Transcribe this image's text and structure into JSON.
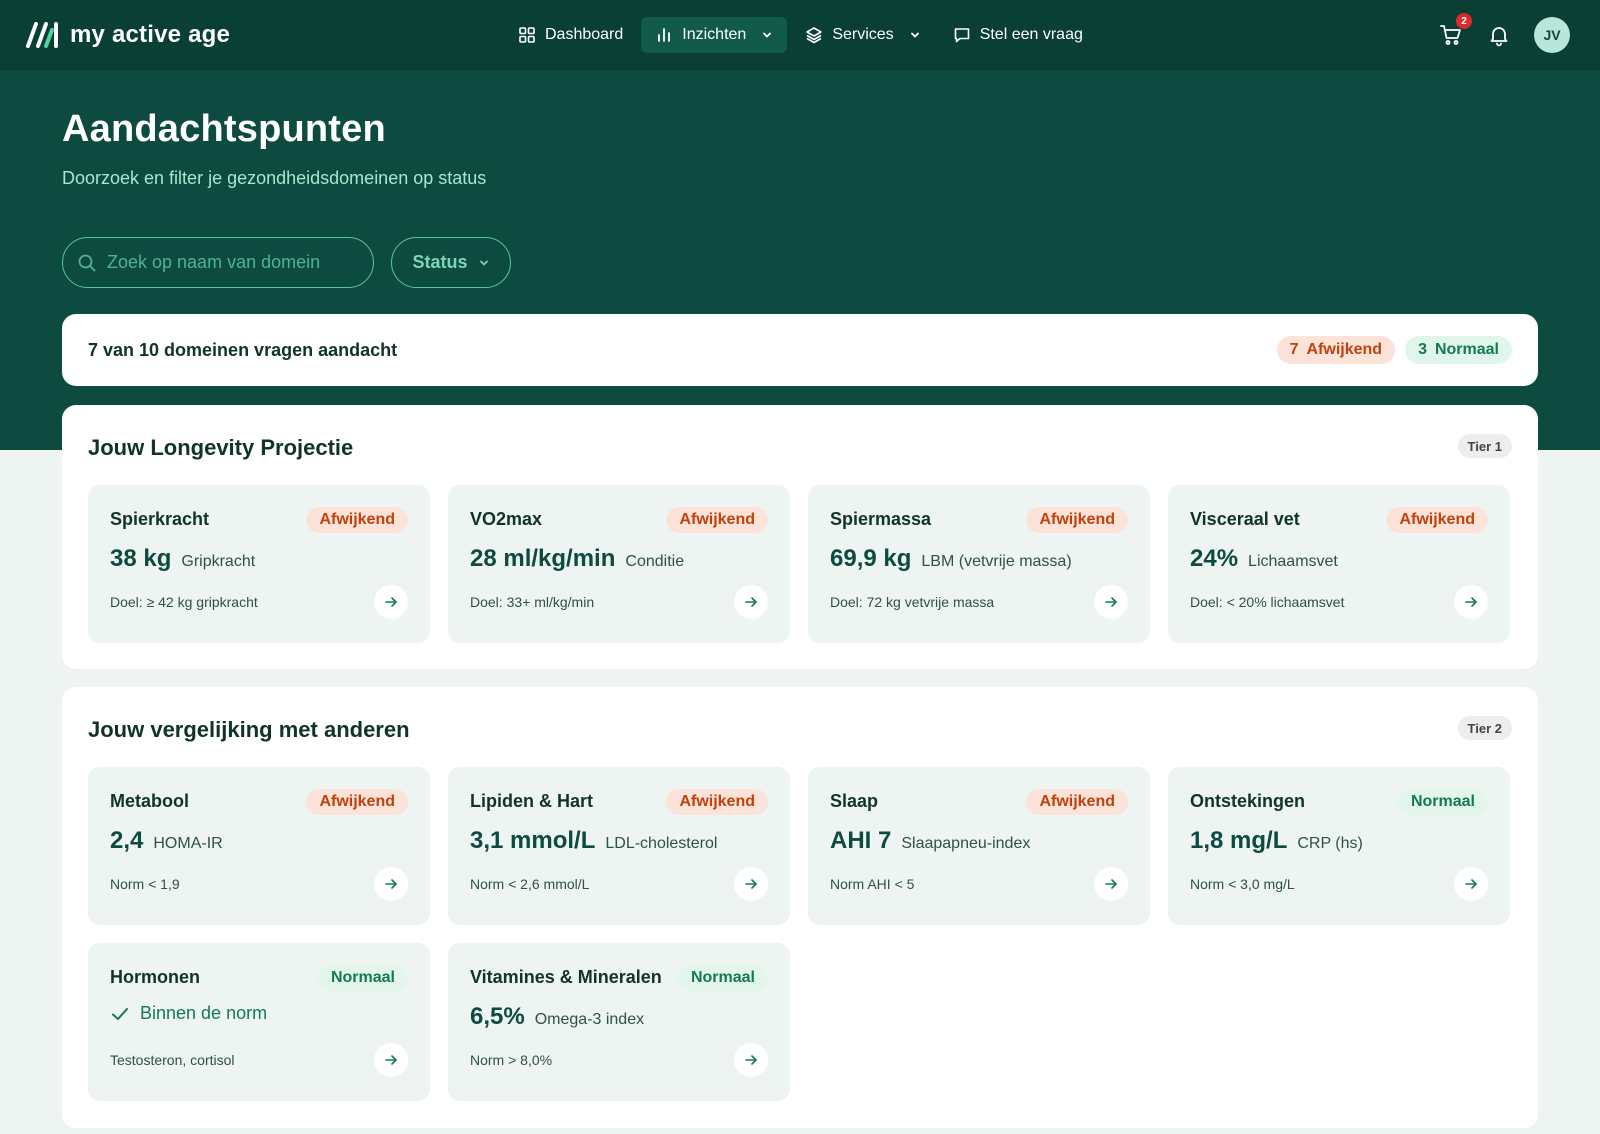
{
  "brand": {
    "name": "my active age"
  },
  "nav": {
    "items": [
      {
        "label": "Dashboard",
        "icon": "grid-icon"
      },
      {
        "label": "Inzichten",
        "icon": "bar-chart-icon"
      },
      {
        "label": "Services",
        "icon": "layers-icon"
      },
      {
        "label": "Stel een vraag",
        "icon": "chat-icon"
      }
    ],
    "cart_count": "2",
    "avatar_initials": "JV"
  },
  "header": {
    "title": "Aandachtspunten",
    "subtitle": "Doorzoek en filter je gezondheidsdomeinen op status"
  },
  "filters": {
    "search_placeholder": "Zoek op naam van domein",
    "status_label": "Status"
  },
  "summary": {
    "text": "7 van 10 domeinen vragen aandacht",
    "deviating_count": "7",
    "deviating_label": "Afwijkend",
    "normal_count": "3",
    "normal_label": "Normaal"
  },
  "sections": [
    {
      "title": "Jouw Longevity Projectie",
      "tier": "Tier 1",
      "cards": [
        {
          "title": "Spierkracht",
          "status": "Afwijkend",
          "value": "38 kg",
          "label": "Gripkracht",
          "note": "Doel: ≥ 42 kg gripkracht"
        },
        {
          "title": "VO2max",
          "status": "Afwijkend",
          "value": "28 ml/kg/min",
          "label": "Conditie",
          "note": "Doel: 33+ ml/kg/min"
        },
        {
          "title": "Spiermassa",
          "status": "Afwijkend",
          "value": "69,9 kg",
          "label": "LBM (vetvrije massa)",
          "note": "Doel: 72 kg vetvrije massa"
        },
        {
          "title": "Visceraal vet",
          "status": "Afwijkend",
          "value": "24%",
          "label": "Lichaamsvet",
          "note": "Doel: < 20% lichaamsvet"
        }
      ]
    },
    {
      "title": "Jouw vergelijking met anderen",
      "tier": "Tier 2",
      "cards": [
        {
          "title": "Metabool",
          "status": "Afwijkend",
          "value": "2,4",
          "label": "HOMA-IR",
          "note": "Norm < 1,9"
        },
        {
          "title": "Lipiden & Hart",
          "status": "Afwijkend",
          "value": "3,1 mmol/L",
          "label": "LDL-cholesterol",
          "note": "Norm < 2,6 mmol/L"
        },
        {
          "title": "Slaap",
          "status": "Afwijkend",
          "value": "AHI 7",
          "label": "Slaapapneu-index",
          "note": "Norm AHI < 5"
        },
        {
          "title": "Ontstekingen",
          "status": "Normaal",
          "value": "1,8 mg/L",
          "label": "CRP (hs)",
          "note": "Norm < 3,0 mg/L"
        },
        {
          "title": "Hormonen",
          "status": "Normaal",
          "check_text": "Binnen de norm",
          "note": "Testosteron, cortisol"
        },
        {
          "title": "Vitamines & Mineralen",
          "status": "Normaal",
          "value": "6,5%",
          "label": "Omega-3 index",
          "note": "Norm > 8,0%"
        }
      ]
    }
  ],
  "colors": {
    "hero": "#0d4a3f",
    "nav": "#0a3f35",
    "warn": "#c2410c",
    "warn_bg": "#fbe3d9",
    "ok": "#137a52",
    "ok_bg": "#e3f6ec"
  }
}
